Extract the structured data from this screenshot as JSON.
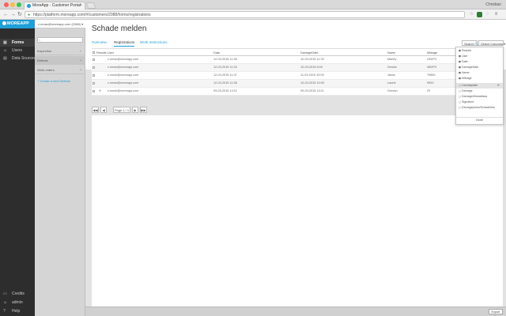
{
  "browser": {
    "tab_title": "MoreApp - Customer Portal",
    "tab_close": "×",
    "user_name": "Christian",
    "url": "https://platform.moreapp.com/#/customers/2088/forms/registrations",
    "back": "←",
    "forward": "→",
    "reload": "↻",
    "star": "☆",
    "menu": "≡"
  },
  "leftnav": {
    "brand": "MOREAPP",
    "items": [
      {
        "label": "Forms",
        "icon": "▦"
      },
      {
        "label": "Users",
        "icon": "☺"
      },
      {
        "label": "Data Sources",
        "icon": "▤"
      }
    ],
    "bottom_items": [
      {
        "label": "Credits",
        "icon": "▭"
      },
      {
        "label": "admin",
        "icon": "☺"
      },
      {
        "label": "Help",
        "icon": "?"
      }
    ]
  },
  "forms_panel": {
    "customer": "c.nmax@moreapp.com (2088) ▾",
    "groups": [
      {
        "label": "Inspection"
      },
      {
        "label": "Defects"
      },
      {
        "label": "Work orders"
      }
    ],
    "create_link": "+ Create a new Defects"
  },
  "main": {
    "title": "Schade melden",
    "tabs": [
      "Overview",
      "Registrations",
      "Work Instructions"
    ],
    "search_label": "Search 🔍",
    "select_columns_label": "Select Columns ▾",
    "export_label": "Export file"
  },
  "table": {
    "headers": [
      "",
      "Results",
      "User",
      "Date",
      "DamageDate",
      "Name",
      "Mileage"
    ],
    "rows": [
      {
        "check": "",
        "user": "c.nmax@moreapp.com",
        "date": "12-03-2015 11:35",
        "damage": "10-03-2015 11:33",
        "name": "Marley",
        "mileage": "235/P3"
      },
      {
        "check": "",
        "user": "c.nmax@moreapp.com",
        "date": "12-03-2015 11:34",
        "damage": "10-03-2015 8:00",
        "name": "Denise",
        "mileage": "450/P3"
      },
      {
        "check": "",
        "user": "c.nmax@moreapp.com",
        "date": "12-03-2015 11:37",
        "damage": "11-03-2015 10:00",
        "name": "Jason",
        "mileage": "79850"
      },
      {
        "check": "",
        "user": "c.nmax@moreapp.com",
        "date": "12-03-2015 11:38",
        "damage": "10-03-2015 10:00",
        "name": "Laurie",
        "mileage": "9900"
      },
      {
        "check": "✔",
        "user": "c.nmax@moreapp.com",
        "date": "09-03-2015 14:11",
        "damage": "09-03-2015 14:11",
        "name": "Gordon",
        "mileage": "20"
      }
    ]
  },
  "pager": {
    "first": "◀◀",
    "prev": "◀",
    "label": "Page 1 / 1",
    "next": "▶",
    "last": "▶▶"
  },
  "column_dropdown": {
    "options": [
      {
        "label": "Results",
        "checked": true
      },
      {
        "label": "User",
        "checked": true
      },
      {
        "label": "Date",
        "checked": true
      },
      {
        "label": "DamageDate",
        "checked": true
      },
      {
        "label": "Name",
        "checked": true
      },
      {
        "label": "Mileage",
        "checked": true
      },
      {
        "label": "Licenseplate",
        "checked": false,
        "selected": true
      },
      {
        "label": "Damage",
        "checked": false
      },
      {
        "label": "DamagedVanaldssa",
        "checked": false
      },
      {
        "label": "Signature",
        "checked": false
      },
      {
        "label": "Damagephoto/Schadefoto",
        "checked": false
      }
    ],
    "done": "Done",
    "remove": "⊗"
  },
  "colors": {
    "brand": "#1e9fd8",
    "leftnav_bg": "#2d2d2d",
    "panel_bg": "#d5d5d5"
  }
}
